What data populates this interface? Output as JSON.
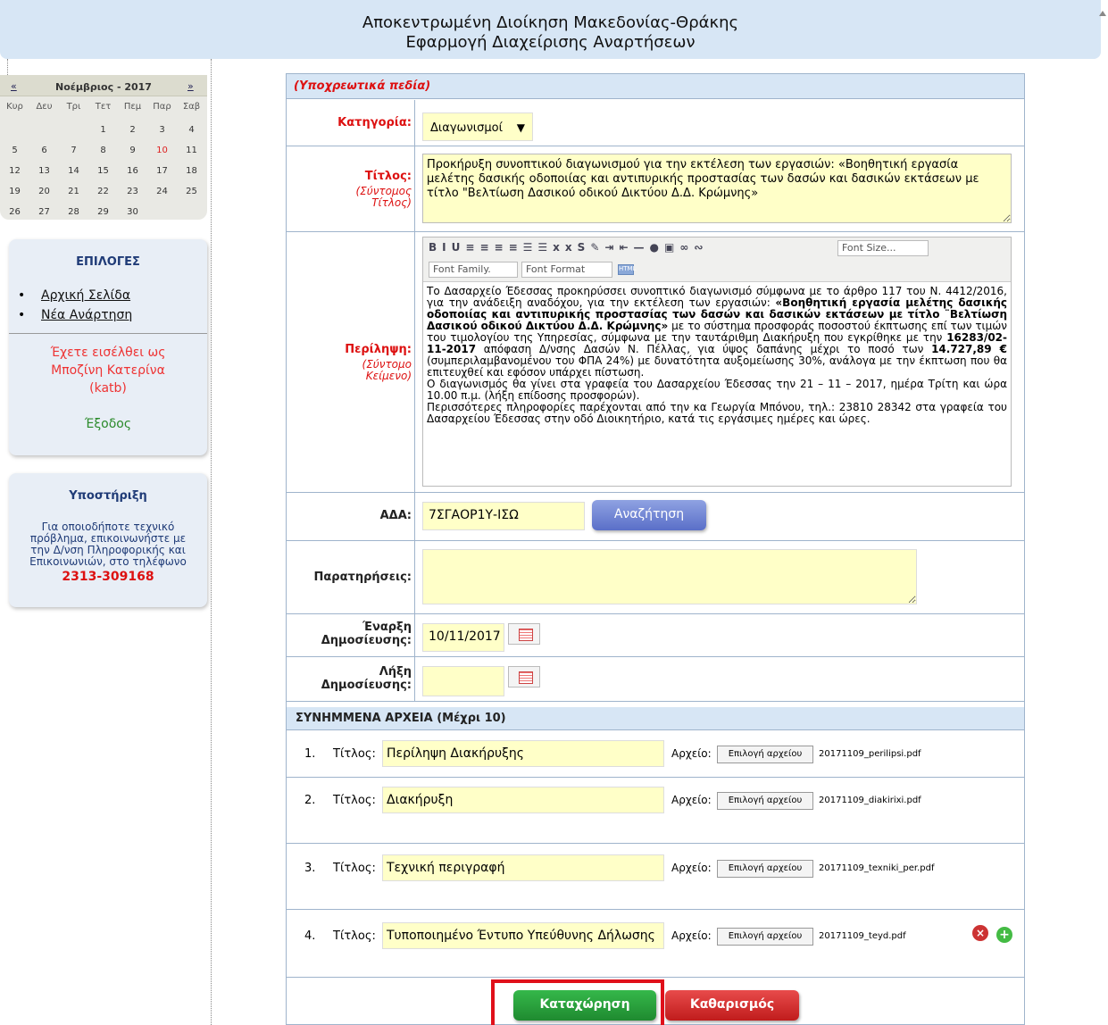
{
  "header": {
    "line1": "Αποκεντρωμένη Διοίκηση Μακεδονίας-Θράκης",
    "line2": "Εφαρμογή Διαχείρισης Αναρτήσεων"
  },
  "calendar": {
    "prev": "«",
    "next": "»",
    "month": "Νοέμβριος - 2017",
    "days": [
      "Κυρ",
      "Δευ",
      "Τρι",
      "Τετ",
      "Πεμ",
      "Παρ",
      "Σαβ"
    ],
    "weeks": [
      [
        "",
        "",
        "",
        "1",
        "2",
        "3",
        "4"
      ],
      [
        "5",
        "6",
        "7",
        "8",
        "9",
        "10",
        "11"
      ],
      [
        "12",
        "13",
        "14",
        "15",
        "16",
        "17",
        "18"
      ],
      [
        "19",
        "20",
        "21",
        "22",
        "23",
        "24",
        "25"
      ],
      [
        "26",
        "27",
        "28",
        "29",
        "30",
        "",
        ""
      ]
    ],
    "today": "10"
  },
  "options": {
    "title": "ΕΠΙΛΟΓΕΣ",
    "links": [
      "Αρχική Σελίδα",
      "Νέα Ανάρτηση"
    ],
    "logged_line1": "Έχετε εισέλθει ως",
    "logged_line2": "Μποζίνη Κατερίνα",
    "logged_line3": "(katb)",
    "logout": "Έξοδος"
  },
  "support": {
    "title": "Υποστήριξη",
    "line1": "Για οποιοδήποτε τεχνικό",
    "line2": "πρόβλημα, επικοινωνήστε με",
    "line3": "την Δ/νση Πληροφορικής και",
    "line4": "Επικοινωνιών, στο τηλέφωνο",
    "phone": "2313-309168"
  },
  "form": {
    "required_note": "(Υποχρεωτικά πεδία)",
    "category_label": "Κατηγορία:",
    "category_value": "Διαγωνισμοί",
    "title_label": "Τίτλος:",
    "title_sub1": "(Σύντομος",
    "title_sub2": "Τίτλος)",
    "title_value": "Προκήρυξη συνοπτικού διαγωνισμού για την εκτέλεση των εργασιών: «Βοηθητική εργασία μελέτης δασικής οδοποιίας και αντιπυρικής προστασίας των δασών και δασικών εκτάσεων με τίτλο \"Βελτίωση Δασικού οδικού Δικτύου Δ.Δ. Κρώμνης»",
    "summary_label": "Περίληψη:",
    "summary_sub1": "(Σύντομο",
    "summary_sub2": "Κείμενο)",
    "editor": {
      "font_size": "Font Size...",
      "font_family": "Font Family.",
      "font_format": "Font Format",
      "html_btn": "HTML",
      "p1_a": "Το Δασαρχείο Έδεσσας προκηρύσσει συνοπτικό διαγωνισμό σύμφωνα με το άρθρο 117 του Ν. 4412/2016, για την ανάδειξη αναδόχου, για την εκτέλεση των εργασιών: ",
      "p1_b": "«Βοηθητική εργασία μελέτης δασικής οδοποιίας και αντιπυρικής προστασίας των δασών και δασικών εκτάσεων με τίτλο ¨Βελτίωση Δασικού οδικού Δικτύου Δ.Δ. Κρώμνης»",
      "p1_c": " με το σύστημα προσφοράς ποσοστού έκπτωσης επί των τιμών του τιμολογίου της Υπηρεσίας, σύμφωνα με την ταυτάριθμη Διακήρυξη που εγκρίθηκε με την ",
      "p1_d": "16283/02-11-2017",
      "p1_e": " απόφαση Δ/νσης Δασών Ν. Πέλλας, για ύψος δαπάνης μέχρι το ποσό των ",
      "p1_f": "14.727,89 €",
      "p1_g": " (συμπεριλαμβανομένου του ΦΠΑ 24%) με δυνατότητα αυξομείωσης 30%, ανάλογα με την έκπτωση που θα επιτευχθεί και εφόσον υπάρχει πίστωση.",
      "p2": "Ο διαγωνισμός θα γίνει στα γραφεία του Δασαρχείου Έδεσσας την 21 – 11 – 2017, ημέρα Τρίτη και ώρα 10.00 π.μ. (λήξη επίδοσης προσφορών).",
      "p3": "Περισσότερες πληροφορίες παρέχονται από την κα Γεωργία Μπόνου, τηλ.: 23810 28342 στα γραφεία του Δασαρχείου Έδεσσας στην οδό Διοικητήριο, κατά τις εργάσιμες ημέρες και ώρες."
    },
    "ada_label": "ΑΔΑ:",
    "ada_value": "7ΣΓΑΟΡ1Υ-ΙΣΩ",
    "search_btn": "Αναζήτηση",
    "notes_label": "Παρατηρήσεις:",
    "notes_value": "",
    "start_label1": "Έναρξη",
    "start_label2": "Δημοσίευσης:",
    "start_value": "10/11/2017",
    "end_label1": "Λήξη",
    "end_label2": "Δημοσίευσης:",
    "end_value": "",
    "attachments_header": "ΣΥΝΗΜΜΕΝΑ ΑΡΧΕΙΑ (Μέχρι 10)",
    "attachments": [
      {
        "num": "1.",
        "label": "Τίτλος:",
        "title": "Περίληψη Διακήρυξης",
        "file_label": "Αρχείο:",
        "file_btn": "Επιλογή αρχείου",
        "file_name": "20171109_perilipsi.pdf"
      },
      {
        "num": "2.",
        "label": "Τίτλος:",
        "title": "Διακήρυξη",
        "file_label": "Αρχείο:",
        "file_btn": "Επιλογή αρχείου",
        "file_name": "20171109_diakirixi.pdf"
      },
      {
        "num": "3.",
        "label": "Τίτλος:",
        "title": "Τεχνική περιγραφή",
        "file_label": "Αρχείο:",
        "file_btn": "Επιλογή αρχείου",
        "file_name": "20171109_texniki_per.pdf"
      },
      {
        "num": "4.",
        "label": "Τίτλος:",
        "title": "Τυποποιημένο Έντυπο Υπεύθυνης Δήλωσης",
        "file_label": "Αρχείο:",
        "file_btn": "Επιλογή αρχείου",
        "file_name": "20171109_teyd.pdf"
      }
    ],
    "submit_btn": "Καταχώρηση",
    "clear_btn": "Καθαρισμός"
  },
  "colors": {
    "header_bg": "#d7e6f5",
    "required_red": "#d11111",
    "input_yellow": "#ffffc8",
    "submit_green": "#2a9e3c",
    "clear_red": "#d02a2a",
    "highlight": "#e0101a"
  },
  "icons": {
    "calendar_picker": "calendar-icon",
    "delete": "remove-icon",
    "add": "add-icon"
  }
}
